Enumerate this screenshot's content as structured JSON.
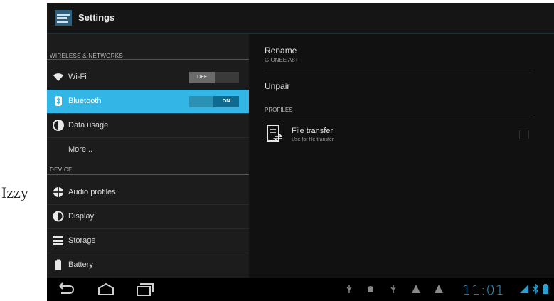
{
  "caption": "Izzy",
  "actionbar": {
    "title": "Settings",
    "icon": "settings-app-icon"
  },
  "sections": {
    "wireless": "WIRELESS & NETWORKS",
    "device": "DEVICE"
  },
  "items": [
    {
      "label": "Wi-Fi",
      "icon": "wifi-icon",
      "toggle": "OFF"
    },
    {
      "label": "Bluetooth",
      "icon": "bluetooth-icon",
      "toggle": "ON",
      "selected": true
    },
    {
      "label": "Data usage",
      "icon": "data-usage-icon"
    },
    {
      "label": "More..."
    },
    {
      "label": "Audio profiles",
      "icon": "audio-profiles-icon"
    },
    {
      "label": "Display",
      "icon": "display-icon"
    },
    {
      "label": "Storage",
      "icon": "storage-icon"
    },
    {
      "label": "Battery",
      "icon": "battery-icon"
    }
  ],
  "detail": {
    "rename_title": "Rename",
    "rename_sub": "GIONEE A8+",
    "unpair": "Unpair",
    "profiles_header": "PROFILES",
    "profile_title": "File transfer",
    "profile_sub": "Use for file transfer"
  },
  "statusbar": {
    "time": "11:01",
    "accent": "#33b5e5"
  }
}
